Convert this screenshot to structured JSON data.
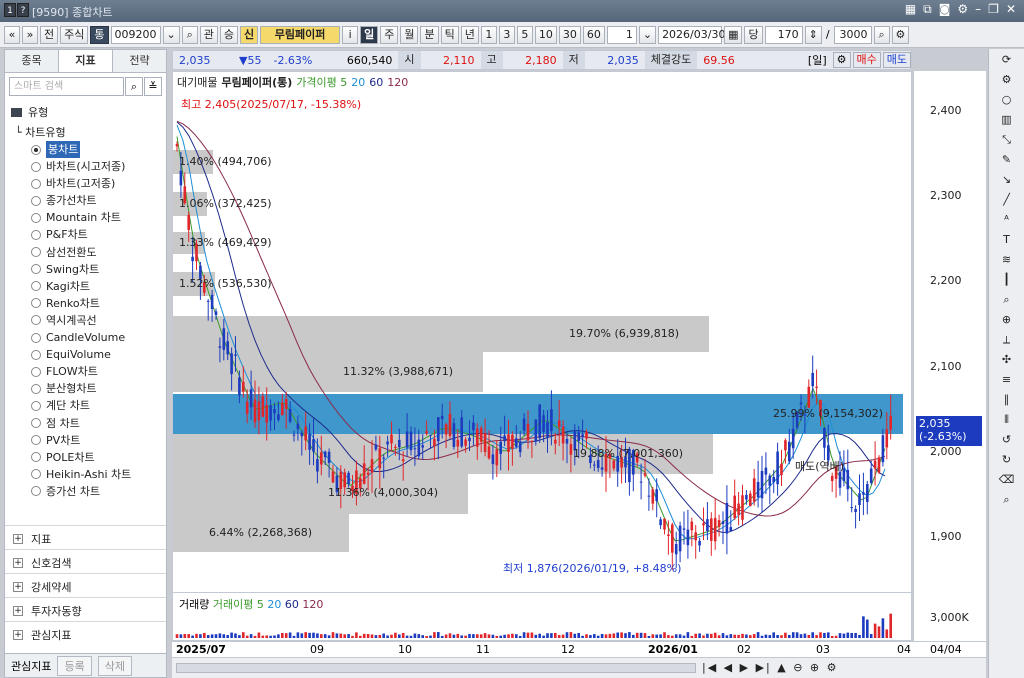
{
  "window": {
    "title": "[9590] 종합차트",
    "controls": [
      "layout-icon",
      "copy-icon",
      "camera-icon",
      "settings-icon",
      "minimize-icon",
      "restore-icon",
      "close-icon"
    ]
  },
  "toolbar": {
    "nav": [
      "«",
      "»"
    ],
    "btn_prev": "전",
    "type": "주식",
    "tong": "통",
    "code": "009200",
    "search": "⌕",
    "gwan": "관",
    "sang": "승",
    "sin": "신",
    "name": "무림페이퍼",
    "info": "i",
    "periods": [
      "일",
      "주",
      "월",
      "분",
      "틱",
      "년"
    ],
    "period_selected": "일",
    "nums": [
      "1",
      "3",
      "5",
      "10",
      "30",
      "60"
    ],
    "unit": "1",
    "date": "2026/03/30",
    "dang": "당",
    "count": "170",
    "slash": "/",
    "total": "3000"
  },
  "left": {
    "tabs": [
      "종목",
      "지표",
      "전략"
    ],
    "active_tab": "지표",
    "search_placeholder": "스마트 검색",
    "group": "유형",
    "subgroup": "차트유형",
    "chart_types": [
      "봉차트",
      "바차트(시고저종)",
      "바차트(고저종)",
      "종가선차트",
      "Mountain 차트",
      "P&F차트",
      "삼선전환도",
      "Swing차트",
      "Kagi차트",
      "Renko차트",
      "역시계곡선",
      "CandleVolume",
      "EquiVolume",
      "FLOW차트",
      "분산형차트",
      "계단 차트",
      "점 차트",
      "PV차트",
      "POLE차트",
      "Heikin-Ashi 차트",
      "증가선 차트"
    ],
    "selected": "봉차트",
    "sections": [
      "지표",
      "신호검색",
      "강세약세",
      "투자자동향",
      "관심지표"
    ],
    "bottom": {
      "label": "관심지표",
      "add": "등록",
      "del": "삭제"
    }
  },
  "infobar": {
    "price": "2,035",
    "change": "▼55",
    "pct": "-2.63%",
    "volume": "660,540",
    "open_label": "시",
    "open": "2,110",
    "high_label": "고",
    "high": "2,180",
    "low_label": "저",
    "low": "2,035",
    "strength_label": "체결강도",
    "strength": "69.56",
    "period": "[일]",
    "buy": "매수",
    "sell": "매도"
  },
  "legend": {
    "items": [
      "대기매물",
      "무림페이퍼(통)",
      "가격이평 5",
      "20",
      "60",
      "120"
    ],
    "colors": [
      "#222",
      "#222",
      "#3a9a2a",
      "#1e8fd6",
      "#1d2a8a",
      "#8a2a4a"
    ]
  },
  "annotations": {
    "high": "최고 2,405(2025/07/17, -15.38%)",
    "low": "최저 1,876(2026/01/19, +8.48%)",
    "cross": "매도(역배)"
  },
  "volume_profile": [
    {
      "label": "1.40% (494,706)"
    },
    {
      "label": "1.06% (372,425)"
    },
    {
      "label": "1.33% (469,429)"
    },
    {
      "label": "1.52% (536,530)"
    },
    {
      "label": "19.70% (6,939,818)"
    },
    {
      "label": "11.32% (3,988,671)"
    },
    {
      "label": "25.99% (9,154,302)"
    },
    {
      "label": "19.88% (7,001,360)"
    },
    {
      "label": "11.36% (4,000,304)"
    },
    {
      "label": "6.44% (2,268,368)"
    }
  ],
  "y_ticks": [
    "2,400",
    "2,300",
    "2,200",
    "2,100",
    "2,000",
    "1,900"
  ],
  "current_price": {
    "value": "2,035",
    "pct": "(-2.63%)"
  },
  "volume_panel": {
    "title": "거래량",
    "ma_label": "거래이평 5",
    "ma": [
      "20",
      "60",
      "120"
    ],
    "tick": "3,000K"
  },
  "x_ticks": [
    "2025/07",
    "09",
    "10",
    "11",
    "12",
    "2026/01",
    "02",
    "03",
    "04"
  ],
  "x_right": "04/04",
  "chart_data": {
    "type": "candlestick",
    "y_range": [
      1860,
      2420
    ],
    "high": {
      "value": 2405,
      "date": "2025/07/17"
    },
    "low": {
      "value": 1876,
      "date": "2026/01/19"
    },
    "last": 2035
  }
}
